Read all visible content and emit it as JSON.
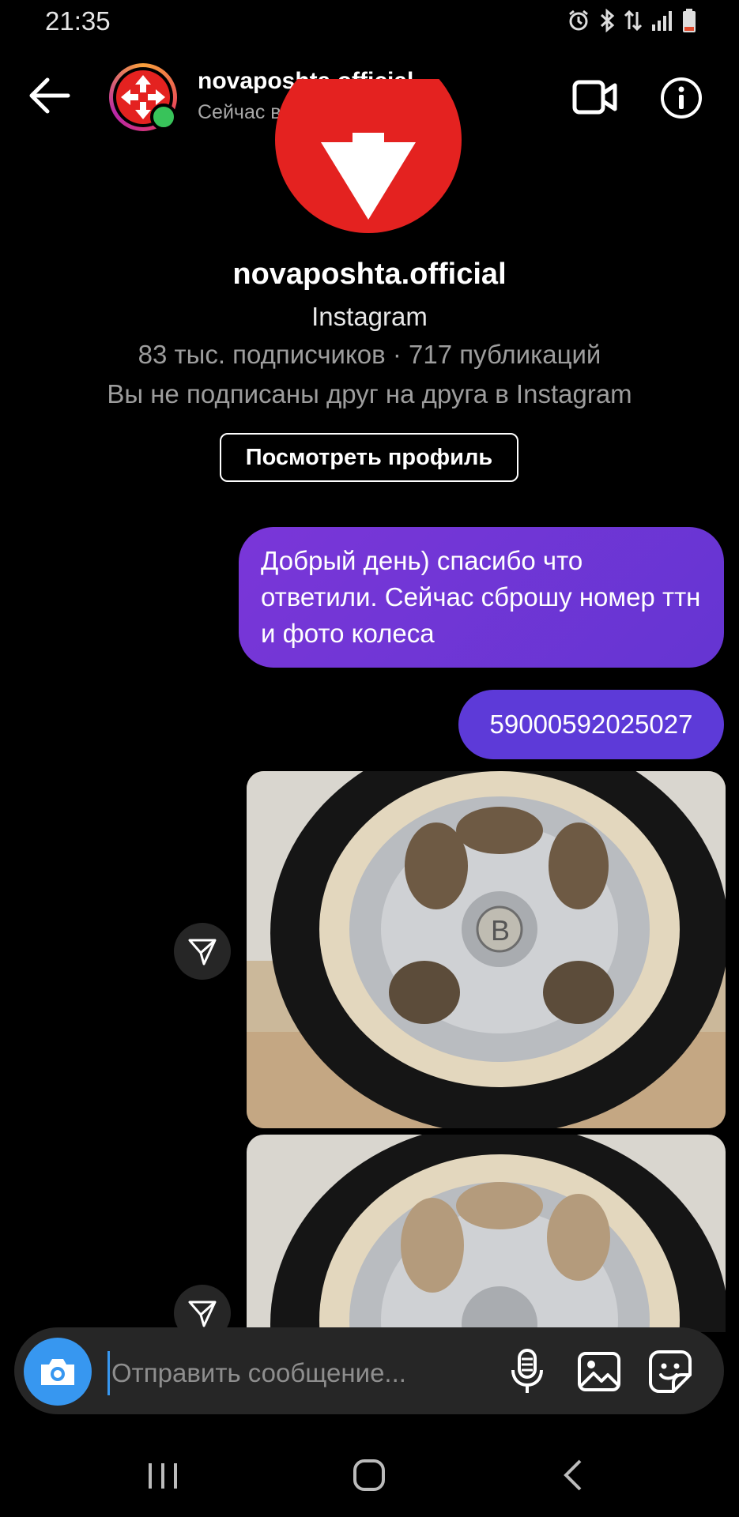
{
  "status_bar": {
    "time": "21:35"
  },
  "header": {
    "name": "novaposhta.official",
    "status": "Сейчас в сети"
  },
  "profile": {
    "name": "novaposhta.official",
    "subtitle": "Instagram",
    "stats": "83 тыс. подписчиков · 717 публикаций",
    "follow_status": "Вы не подписаны друг на друга в Instagram",
    "view_profile_label": "Посмотреть профиль"
  },
  "messages": [
    {
      "text": "Добрый день) спасибо что ответили. Сейчас сброшу номер ттн и фото колеса"
    },
    {
      "text": "59000592025027"
    }
  ],
  "composer": {
    "placeholder": "Отправить сообщение..."
  },
  "colors": {
    "brand_red": "#e42220",
    "bubble_purple": "#6a36d4",
    "accent_blue": "#3797f0",
    "online_green": "#38c35a"
  }
}
